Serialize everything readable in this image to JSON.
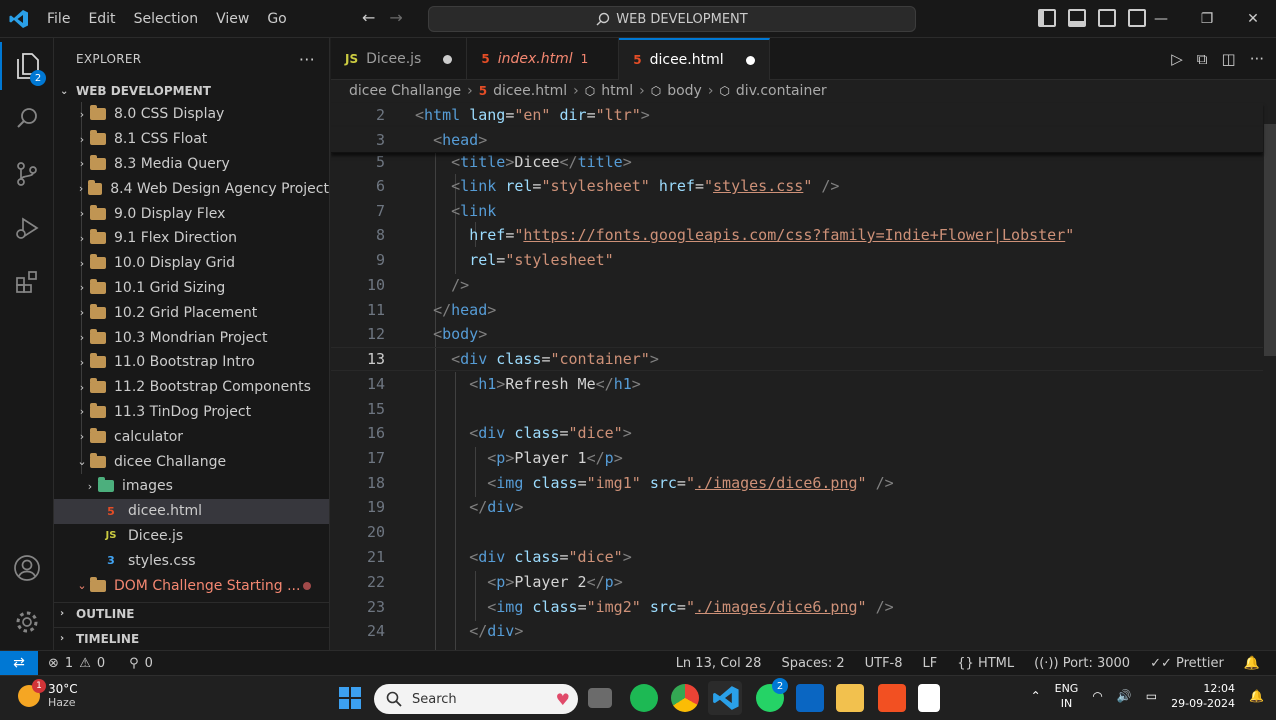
{
  "titlebar": {
    "menu": [
      "File",
      "Edit",
      "Selection",
      "View",
      "Go"
    ],
    "search_text": "WEB DEVELOPMENT",
    "nav_back": "←",
    "nav_forward": "→",
    "win_min": "—",
    "win_max": "❐",
    "win_close": "✕"
  },
  "activity": {
    "explorer_badge": "2"
  },
  "sidebar": {
    "title": "EXPLORER",
    "more": "···",
    "workspace": "WEB DEVELOPMENT",
    "folders": [
      "8.0 CSS Display",
      "8.1 CSS Float",
      "8.3 Media Query",
      "8.4 Web Design Agency Project",
      "9.0 Display Flex",
      "9.1 Flex Direction",
      "10.0 Display Grid",
      "10.1 Grid Sizing",
      "10.2 Grid Placement",
      "10.3 Mondrian Project",
      "11.0 Bootstrap Intro",
      "11.2 Bootstrap Components",
      "11.3 TinDog Project",
      "calculator"
    ],
    "open_folder": "dicee Challange",
    "images_folder": "images",
    "files": {
      "html": "dicee.html",
      "js": "Dicee.js",
      "css": "styles.css"
    },
    "dom_folder": "DOM Challenge Starting ...",
    "outline": "OUTLINE",
    "timeline": "TIMELINE"
  },
  "tabs": [
    {
      "icon": "JS",
      "label": "Dicee.js"
    },
    {
      "icon": "5",
      "label": "index.html",
      "suffix": "1"
    },
    {
      "icon": "5",
      "label": "dicee.html"
    }
  ],
  "breadcrumb": [
    "dicee Challange",
    "dicee.html",
    "html",
    "body",
    "div.container"
  ],
  "editor": {
    "lines": [
      "2",
      "3",
      "5",
      "6",
      "7",
      "8",
      "9",
      "10",
      "11",
      "12",
      "13",
      "14",
      "15",
      "16",
      "17",
      "18",
      "19",
      "20",
      "21",
      "22",
      "23",
      "24"
    ]
  },
  "statusbar": {
    "errors": "1",
    "warnings": "0",
    "ports_count": "0",
    "position": "Ln 13, Col 28",
    "spaces": "Spaces: 2",
    "encoding": "UTF-8",
    "eol": "LF",
    "language": "HTML",
    "port": "Port: 3000",
    "prettier": "Prettier"
  },
  "taskbar": {
    "temp": "30°C",
    "weather": "Haze",
    "weather_badge": "1",
    "search": "Search",
    "lang1": "ENG",
    "lang2": "IN",
    "time": "12:04",
    "date": "29-09-2024",
    "vscode_badge": "2"
  }
}
